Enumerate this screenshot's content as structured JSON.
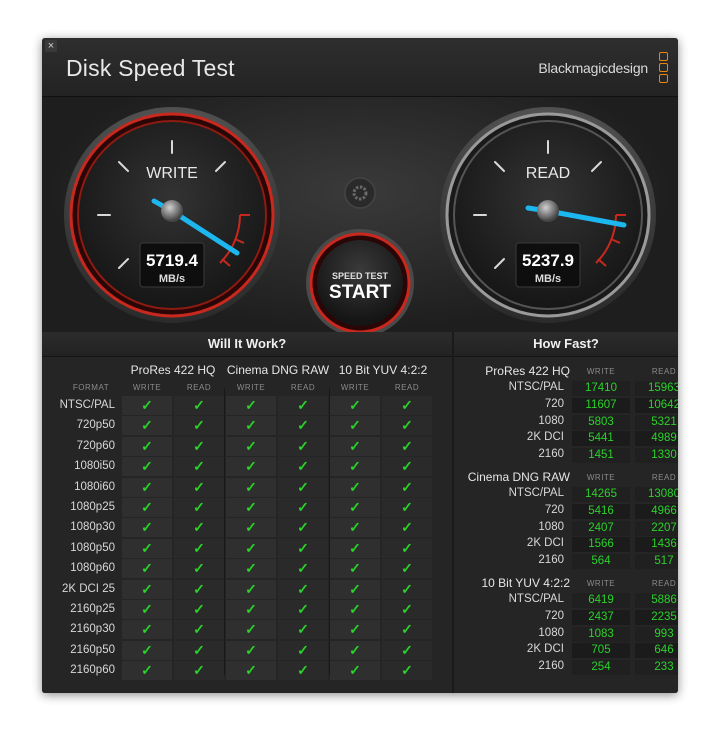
{
  "window": {
    "title": "Disk Speed Test",
    "brand": "Blackmagicdesign",
    "close_glyph": "×"
  },
  "colors": {
    "needle": "#1db7f0",
    "check": "#2bd12b",
    "ring": "#c8281d",
    "logo": "#e8870f"
  },
  "write_gauge": {
    "label": "WRITE",
    "value": "5719.4",
    "unit": "MB/s"
  },
  "read_gauge": {
    "label": "READ",
    "value": "5237.9",
    "unit": "MB/s"
  },
  "start_button": {
    "line1": "SPEED TEST",
    "line2": "START"
  },
  "settings_icon": "gear-icon",
  "will_it_work": {
    "title": "Will It Work?",
    "format_label": "FORMAT",
    "groups": [
      "ProRes 422 HQ",
      "Cinema DNG RAW",
      "10 Bit YUV 4:2:2"
    ],
    "cols": [
      "WRITE",
      "READ",
      "WRITE",
      "READ",
      "WRITE",
      "READ"
    ],
    "check": "✓",
    "rows": [
      "NTSC/PAL",
      "720p50",
      "720p60",
      "1080i50",
      "1080i60",
      "1080p25",
      "1080p30",
      "1080p50",
      "1080p60",
      "2K DCI 25",
      "2160p25",
      "2160p30",
      "2160p50",
      "2160p60"
    ]
  },
  "how_fast": {
    "title": "How Fast?",
    "write_label": "WRITE",
    "read_label": "READ",
    "groups": [
      {
        "name": "ProRes 422 HQ",
        "rows": [
          {
            "label": "NTSC/PAL",
            "write": "17410",
            "read": "15963"
          },
          {
            "label": "720",
            "write": "11607",
            "read": "10642"
          },
          {
            "label": "1080",
            "write": "5803",
            "read": "5321"
          },
          {
            "label": "2K DCI",
            "write": "5441",
            "read": "4989"
          },
          {
            "label": "2160",
            "write": "1451",
            "read": "1330"
          }
        ]
      },
      {
        "name": "Cinema DNG RAW",
        "rows": [
          {
            "label": "NTSC/PAL",
            "write": "14265",
            "read": "13080"
          },
          {
            "label": "720",
            "write": "5416",
            "read": "4966"
          },
          {
            "label": "1080",
            "write": "2407",
            "read": "2207"
          },
          {
            "label": "2K DCI",
            "write": "1566",
            "read": "1436"
          },
          {
            "label": "2160",
            "write": "564",
            "read": "517"
          }
        ]
      },
      {
        "name": "10 Bit YUV 4:2:2",
        "rows": [
          {
            "label": "NTSC/PAL",
            "write": "6419",
            "read": "5886"
          },
          {
            "label": "720",
            "write": "2437",
            "read": "2235"
          },
          {
            "label": "1080",
            "write": "1083",
            "read": "993"
          },
          {
            "label": "2K DCI",
            "write": "705",
            "read": "646"
          },
          {
            "label": "2160",
            "write": "254",
            "read": "233"
          }
        ]
      }
    ]
  }
}
